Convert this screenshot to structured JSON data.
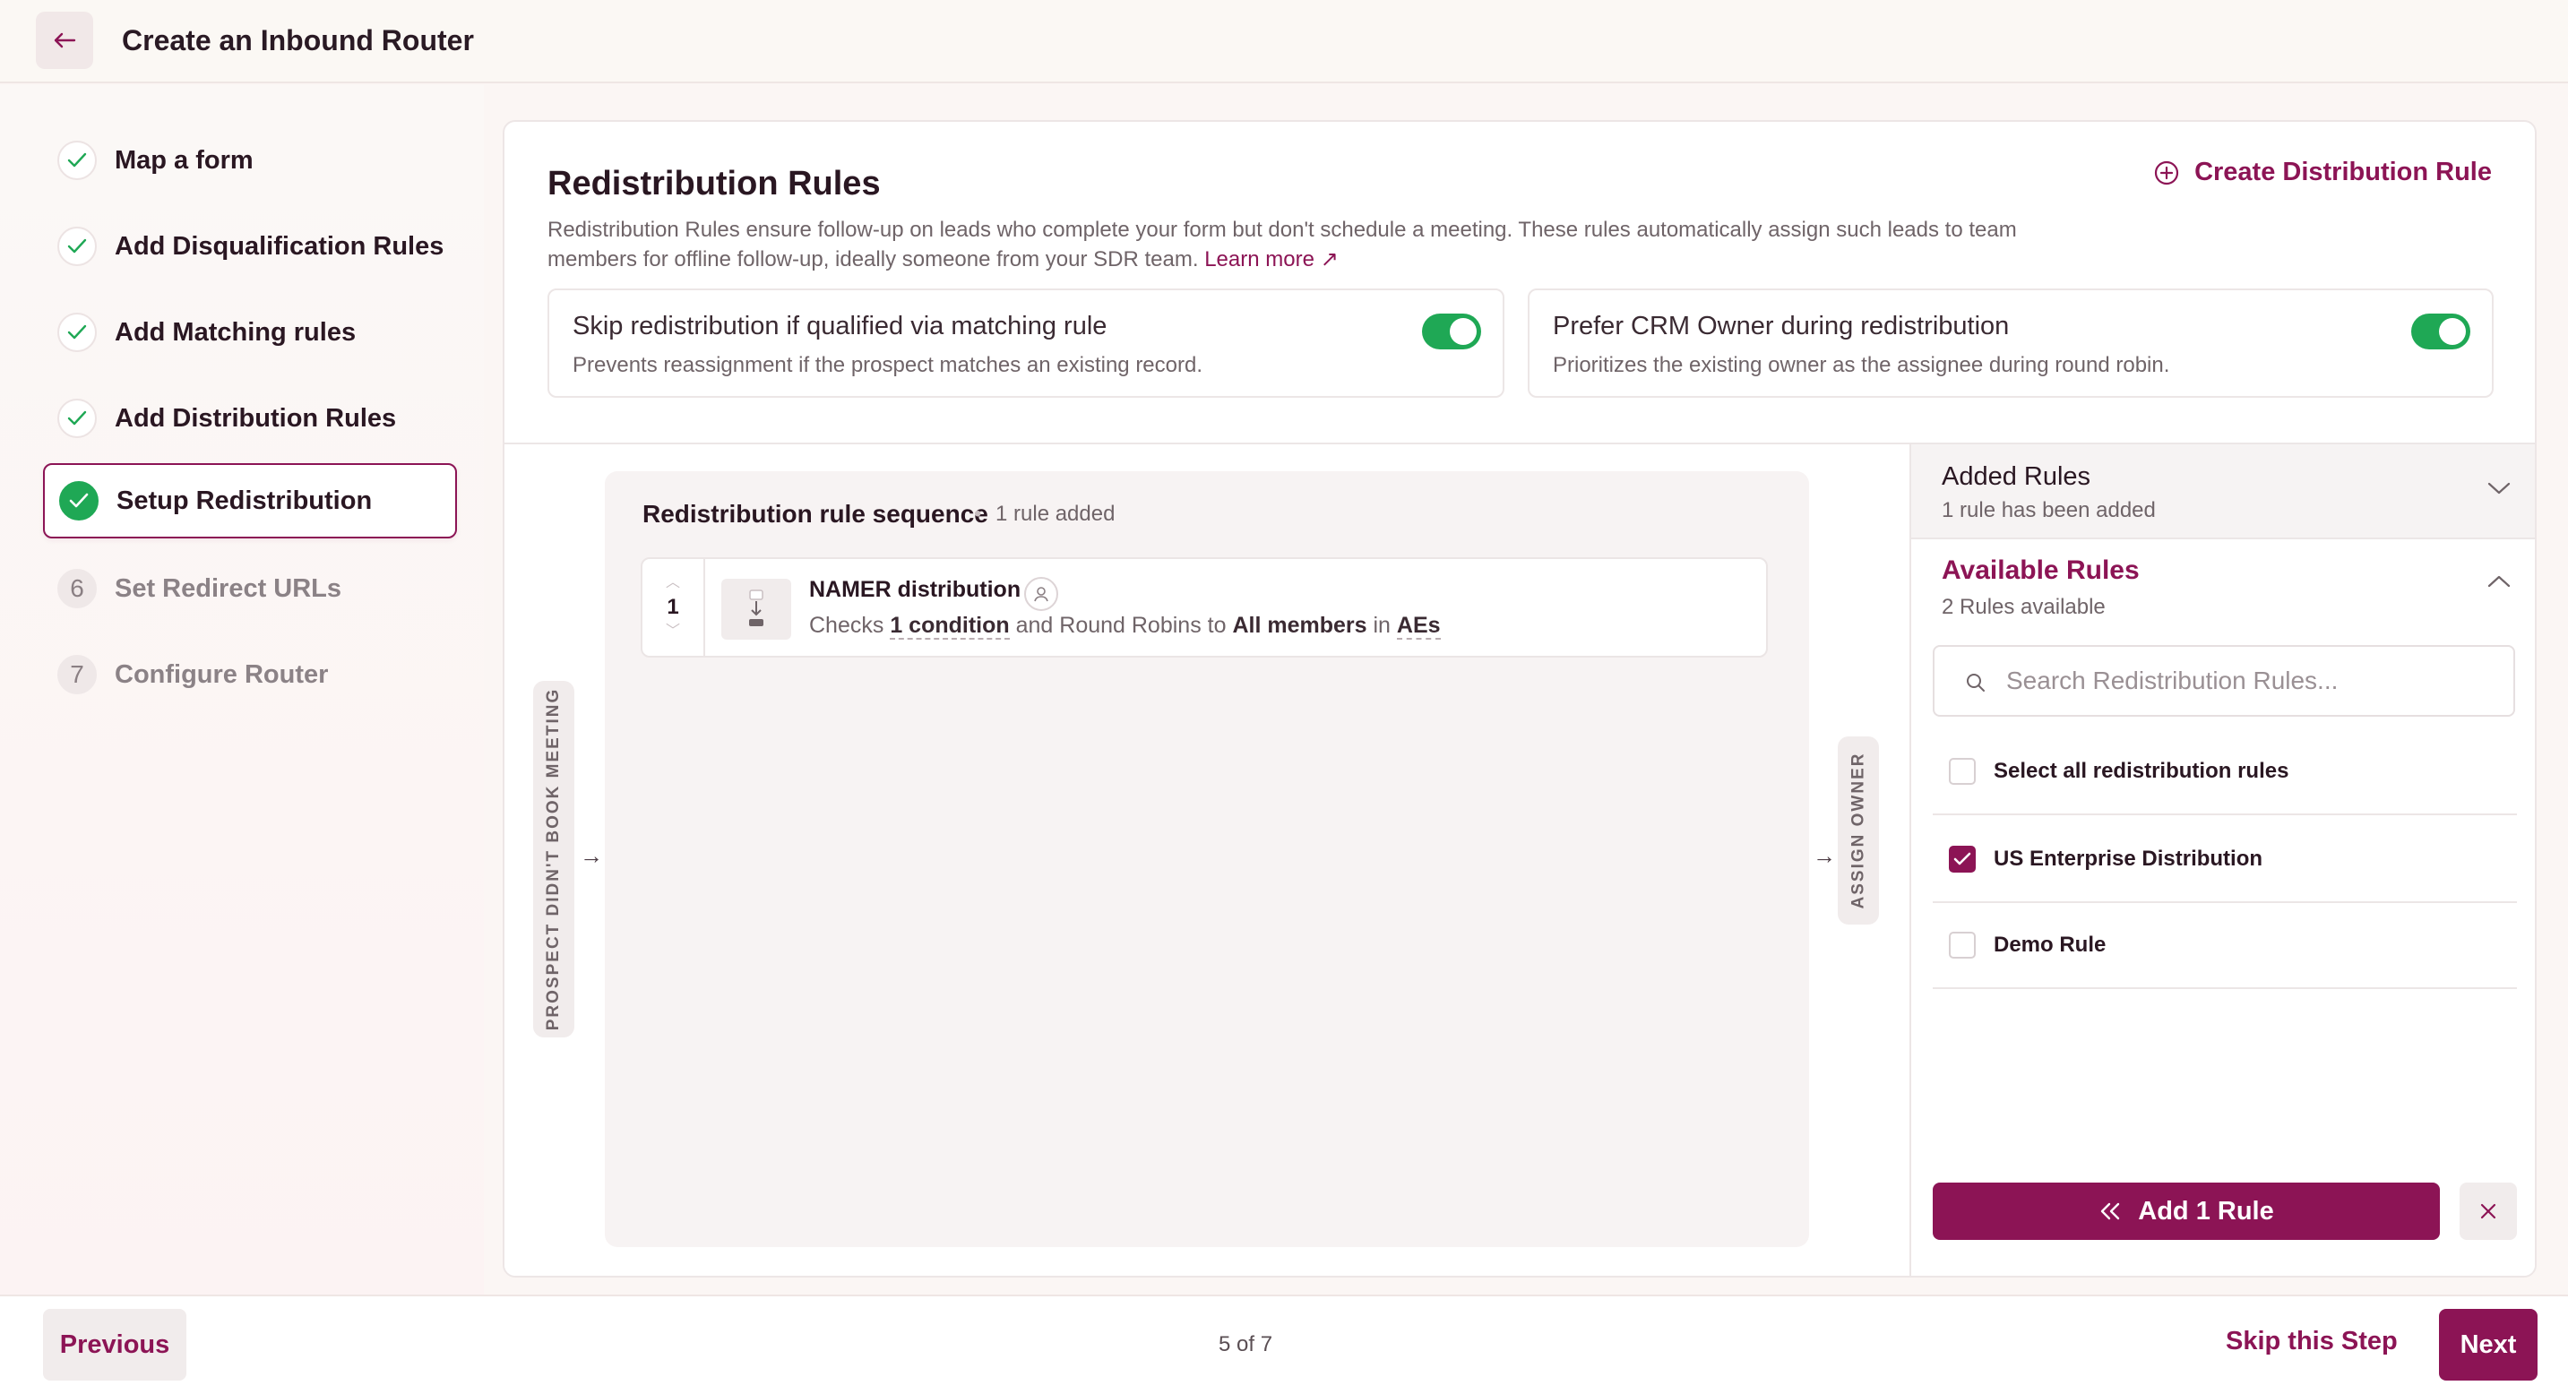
{
  "header": {
    "title": "Create an Inbound Router"
  },
  "sidebar": {
    "steps": [
      {
        "label": "Map a form",
        "status": "done"
      },
      {
        "label": "Add Disqualification Rules",
        "status": "done"
      },
      {
        "label": "Add Matching rules",
        "status": "done"
      },
      {
        "label": "Add Distribution Rules",
        "status": "done"
      },
      {
        "label": "Setup Redistribution",
        "status": "active"
      },
      {
        "label": "Set Redirect URLs",
        "status": "pending",
        "number": "6"
      },
      {
        "label": "Configure Router",
        "status": "pending",
        "number": "7"
      }
    ]
  },
  "main": {
    "title": "Redistribution Rules",
    "description": "Redistribution Rules ensure follow-up on leads who complete your form but don't schedule a meeting. These rules automatically assign such leads to team members for offline follow-up, ideally someone from your SDR team.",
    "learn_more": "Learn more ↗",
    "create_rule_label": "Create Distribution Rule",
    "options": [
      {
        "title": "Skip redistribution if qualified via matching rule",
        "desc": "Prevents reassignment if the prospect matches an existing record.",
        "enabled": true
      },
      {
        "title": "Prefer CRM Owner during redistribution",
        "desc": "Prioritizes the existing owner as the assignee during round robin.",
        "enabled": true
      }
    ],
    "flow": {
      "left_label": "PROSPECT DIDN'T BOOK MEETING",
      "right_label": "ASSIGN OWNER",
      "sequence_title": "Redistribution rule sequence",
      "sequence_count": "1 rule added",
      "rules": [
        {
          "order": "1",
          "name": "NAMER distribution",
          "desc_prefix": "Checks",
          "condition": "1 condition",
          "desc_mid": "and Round Robins to",
          "members": "All members",
          "desc_in": "in",
          "team": "AEs"
        }
      ]
    }
  },
  "right_panel": {
    "added_title": "Added Rules",
    "added_sub": "1 rule has been added",
    "available_title": "Available Rules",
    "available_sub": "2 Rules available",
    "search_placeholder": "Search Redistribution Rules...",
    "select_all_label": "Select all redistribution rules",
    "rules": [
      {
        "label": "US Enterprise Distribution",
        "checked": true
      },
      {
        "label": "Demo Rule",
        "checked": false
      }
    ],
    "add_button": "Add 1 Rule"
  },
  "footer": {
    "previous": "Previous",
    "step_count": "5 of 7",
    "skip": "Skip this Step",
    "next": "Next"
  },
  "colors": {
    "brand": "#8c1455",
    "success": "#1fa855"
  }
}
